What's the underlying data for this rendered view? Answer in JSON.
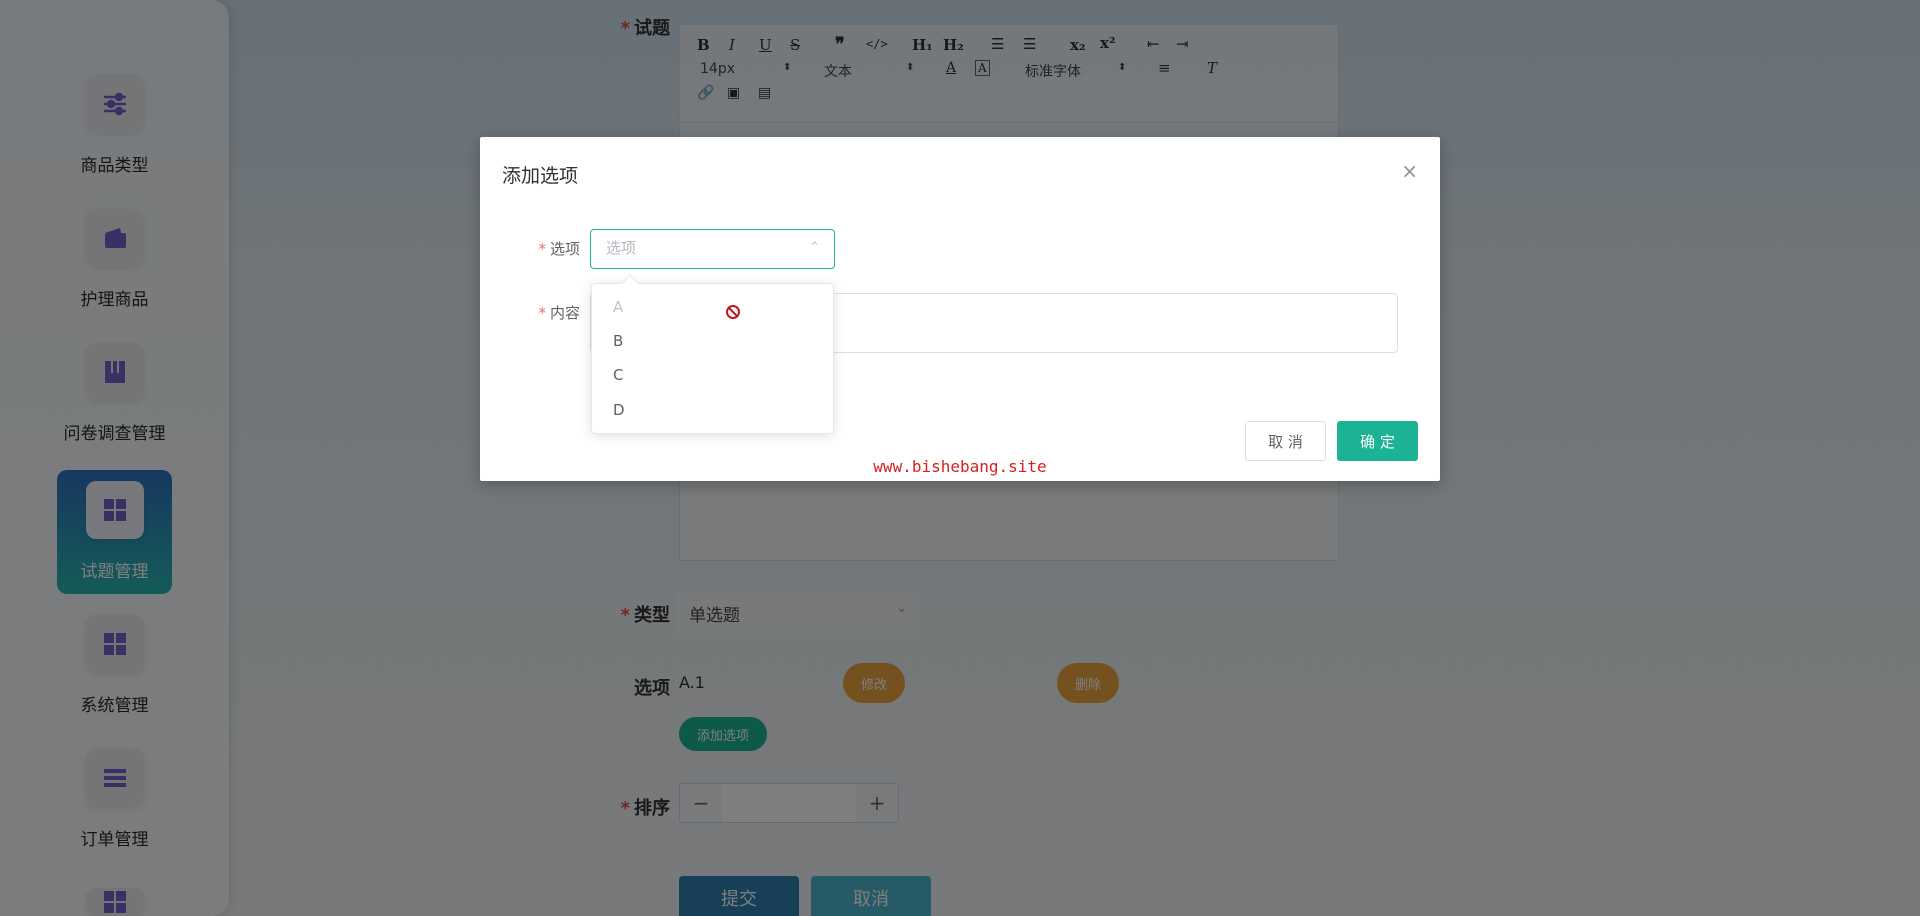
{
  "sidebar": {
    "items": [
      {
        "label": "商品类型",
        "icon": "sliders-icon"
      },
      {
        "label": "护理商品",
        "icon": "wallet-icon"
      },
      {
        "label": "问卷调查管理",
        "icon": "book-icon"
      },
      {
        "label": "试题管理",
        "icon": "grid-icon",
        "active": true
      },
      {
        "label": "系统管理",
        "icon": "grid-icon"
      },
      {
        "label": "订单管理",
        "icon": "list-icon"
      }
    ]
  },
  "form": {
    "question_label": "试题",
    "type_label": "类型",
    "type_value": "单选题",
    "options_label": "选项",
    "option_item": "A.1",
    "edit_label": "修改",
    "delete_label": "删除",
    "add_option_label": "添加选项",
    "sort_label": "排序",
    "minus": "−",
    "plus": "+",
    "submit_label": "提交",
    "cancel_label": "取消"
  },
  "editor_toolbar": {
    "font_size": "14px",
    "block": "文本",
    "font_family": "标准字体"
  },
  "dialog": {
    "title": "添加选项",
    "close": "×",
    "option_label": "选项",
    "option_placeholder": "选项",
    "content_label": "内容",
    "cancel_label": "取 消",
    "confirm_label": "确 定",
    "watermark": "www.bishebang.site"
  },
  "dropdown": {
    "options": [
      {
        "label": "A",
        "disabled": true
      },
      {
        "label": "B",
        "disabled": false
      },
      {
        "label": "C",
        "disabled": false
      },
      {
        "label": "D",
        "disabled": false
      }
    ]
  },
  "colors": {
    "accent": "#1bb394",
    "active_nav_top": "#2e6fc0",
    "active_nav_bottom": "#29b8b0",
    "orange_pill": "#e8a33d",
    "required": "#e24a4a"
  }
}
